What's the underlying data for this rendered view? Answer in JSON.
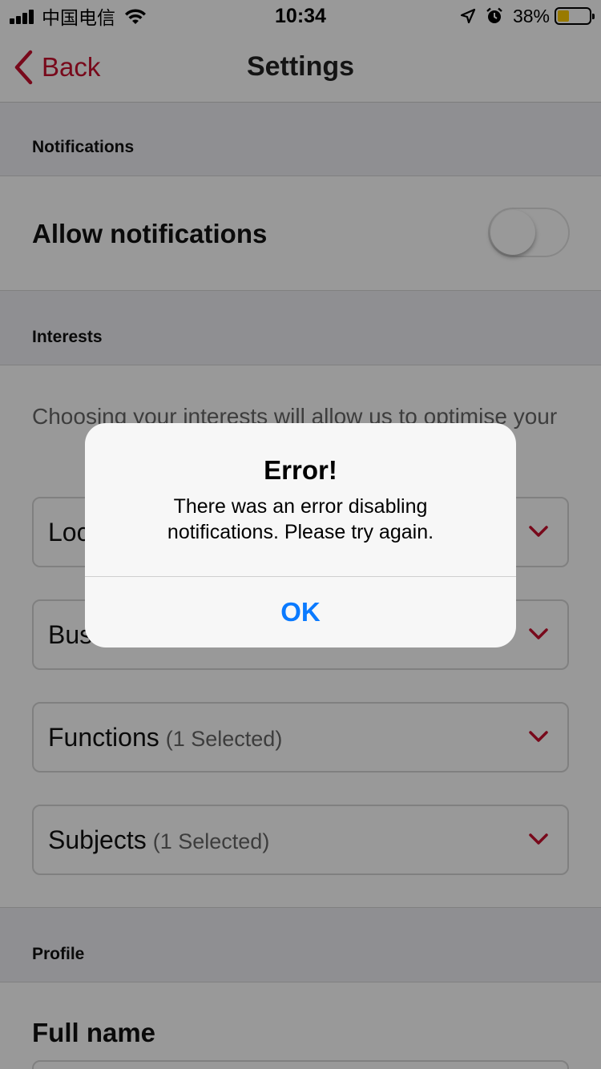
{
  "status_bar": {
    "carrier": "中国电信",
    "time": "10:34",
    "battery_percent": "38%",
    "battery_level": 0.38,
    "icons": [
      "signal-icon",
      "wifi-icon",
      "location-arrow-icon",
      "alarm-icon",
      "battery-icon"
    ]
  },
  "nav": {
    "back_label": "Back",
    "title": "Settings",
    "accent_color": "#c8102e"
  },
  "sections": {
    "notifications": "Notifications",
    "interests": "Interests",
    "profile": "Profile"
  },
  "notifications": {
    "allow_label": "Allow notifications",
    "toggle_on": false
  },
  "interests": {
    "description": "Choosing your interests will allow us to optimise your",
    "dropdowns": [
      {
        "label": "Loc",
        "count": ""
      },
      {
        "label": "Bus",
        "count": ""
      },
      {
        "label": "Functions",
        "count": "(1 Selected)"
      },
      {
        "label": "Subjects",
        "count": "(1 Selected)"
      }
    ]
  },
  "profile": {
    "full_name_label": "Full name"
  },
  "alert": {
    "title": "Error!",
    "message": "There was an error disabling notifications. Please try again.",
    "ok_label": "OK",
    "ok_color": "#0a7aff"
  }
}
